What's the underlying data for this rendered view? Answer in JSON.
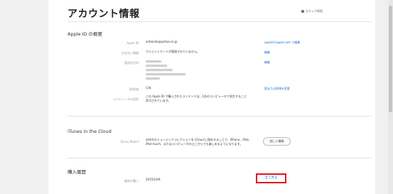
{
  "header": {
    "title": "アカウント情報",
    "secure_label": "セキュア接続"
  },
  "apple_id": {
    "section_title": "Apple ID の概要",
    "rows": [
      {
        "label": "Apple ID：",
        "value": "antaanbi@yahoo.co.jp",
        "link": "appleid.apple.com で編集"
      },
      {
        "label": "お支払い情報：",
        "value": "クレジットカードが登録されていません。",
        "link": "編集"
      },
      {
        "label": "請求先住所：",
        "value": "",
        "link": "編集"
      },
      {
        "label": "国/地域：",
        "value": "日本",
        "link": "国または地域を変更"
      },
      {
        "label": "コンピュータの認証：",
        "value": "この Apple ID で購入されたコンテンツは、1台のコンピュータで再生すること",
        "value2": "許可されています。"
      }
    ]
  },
  "itunes_cloud": {
    "section_title": "iTunes in the Cloud",
    "label": "iTunes Match：",
    "value": "お持ちのミュージックコレクションを iCloud に保存することで、iPhone、iPad、",
    "value2": "iPod touch、またはコンピュータのどこからでも楽しめるようになります。",
    "button": "詳しい情報"
  },
  "purchase_history": {
    "section_title": "購入履歴",
    "label": "最新の購入：",
    "value": "2015/10/9",
    "see_all": "全て見る"
  }
}
